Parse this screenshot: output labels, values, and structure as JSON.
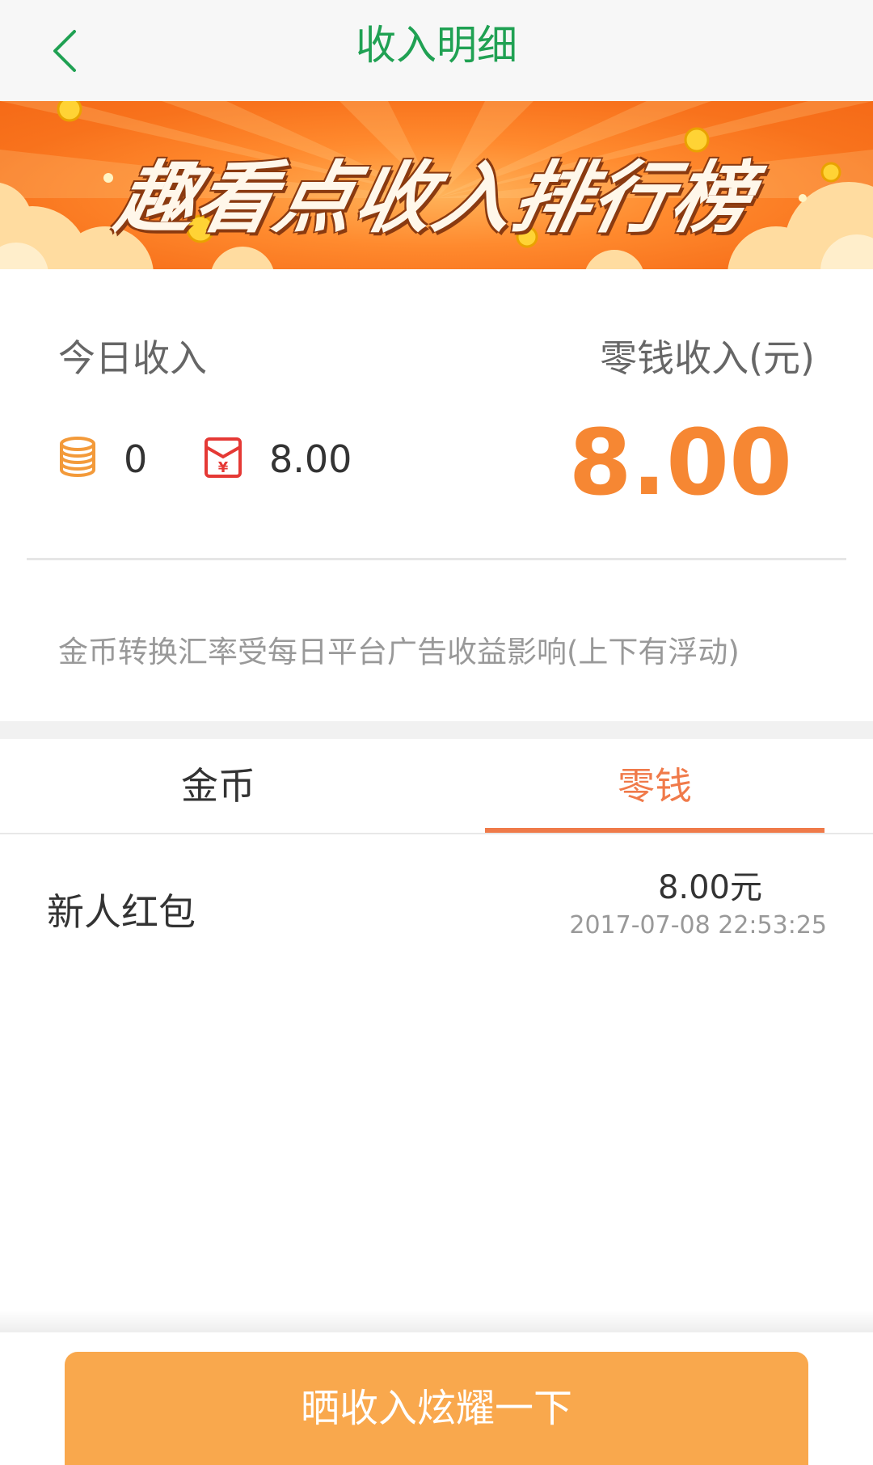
{
  "header": {
    "title": "收入明细",
    "back_icon": "chevron-left-icon",
    "accent": "#20a153"
  },
  "banner": {
    "text": "趣看点收入排行榜"
  },
  "summary": {
    "today_label": "今日收入",
    "wallet_label": "零钱收入(元)",
    "today_coins": "0",
    "today_cash": "8.00",
    "wallet_amount": "8.00",
    "coin_icon": "coin-stack-icon",
    "red_packet_icon": "red-packet-icon",
    "amount_color": "#f68733"
  },
  "notice": "金币转换汇率受每日平台广告收益影响(上下有浮动)",
  "tabs": [
    {
      "label": "金币",
      "active": false
    },
    {
      "label": "零钱",
      "active": true
    }
  ],
  "records": [
    {
      "title": "新人红包",
      "amount": "8.00元",
      "time": "2017-07-08 22:53:25"
    }
  ],
  "share_button": {
    "label": "晒收入炫耀一下",
    "color": "#f9a84d"
  }
}
